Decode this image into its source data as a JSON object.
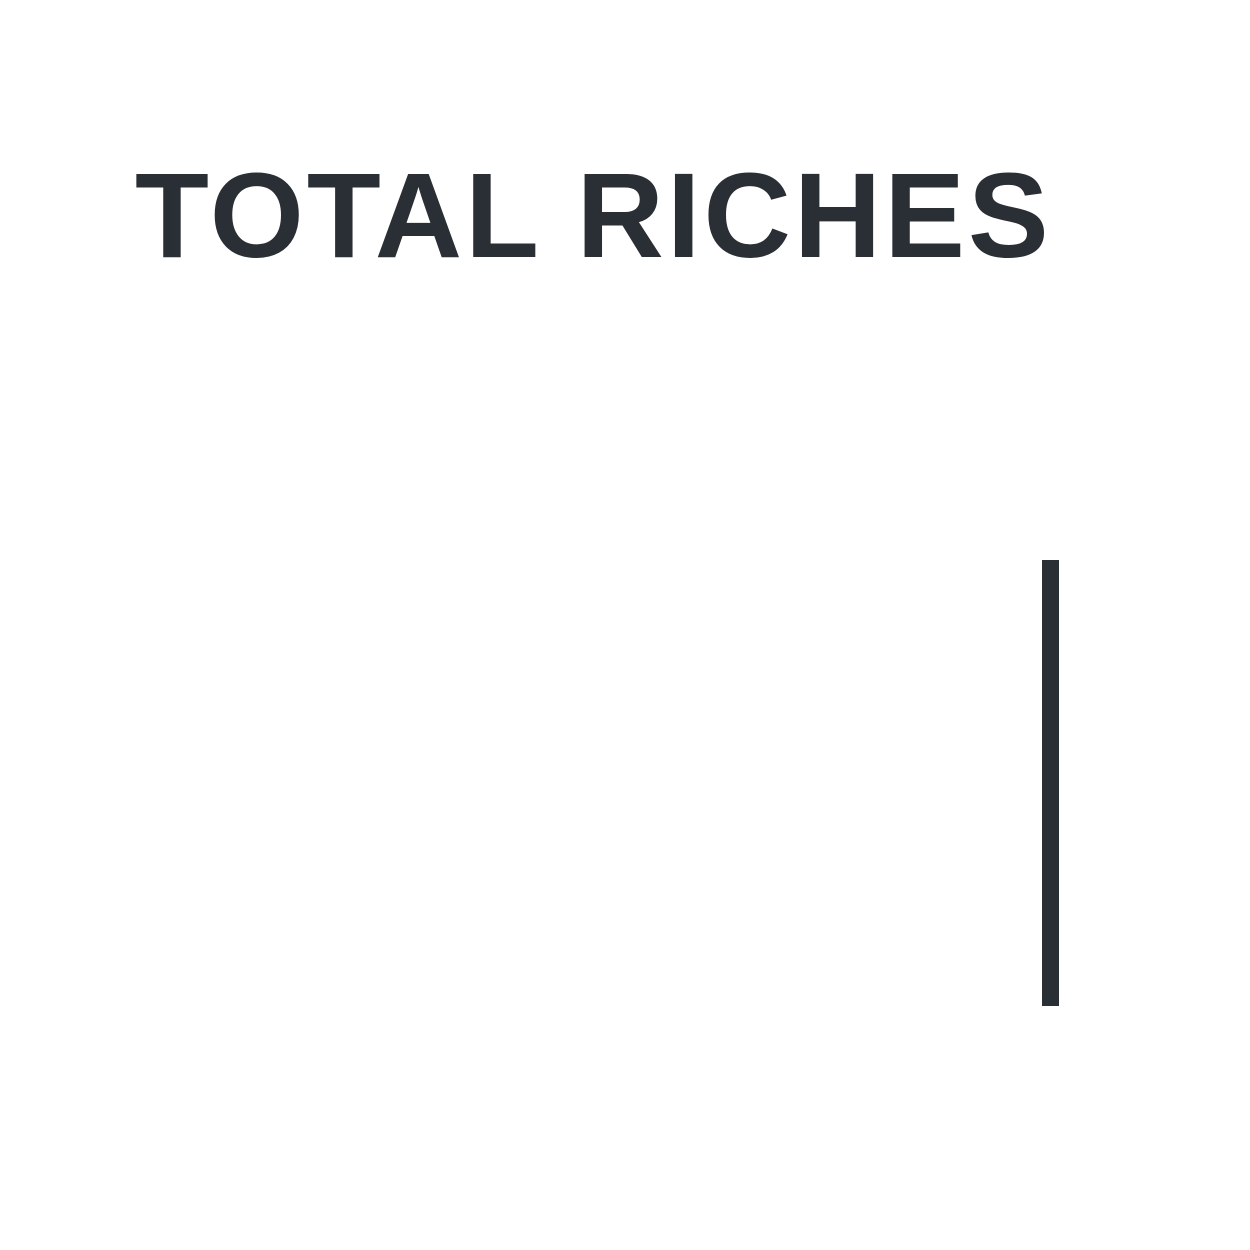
{
  "headline": {
    "text": "TOTAL RICHES"
  },
  "colors": {
    "background": "#ffffff",
    "ink": "#2a2e35"
  }
}
